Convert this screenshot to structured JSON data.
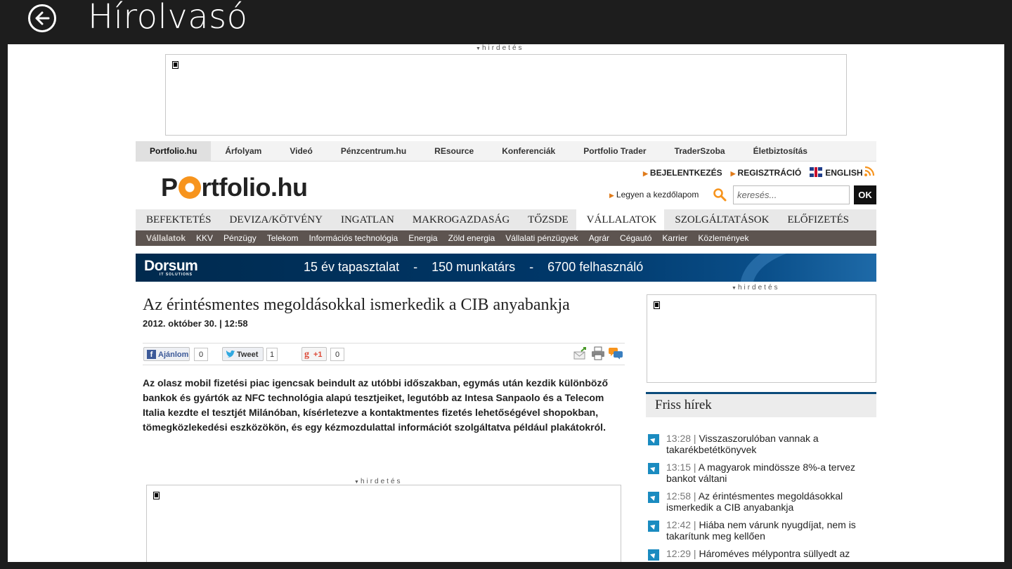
{
  "app": {
    "title": "Hírolvasó"
  },
  "ads": {
    "label": "hirdetés"
  },
  "topnav": [
    "Portfolio.hu",
    "Árfolyam",
    "Videó",
    "Pénzcentrum.hu",
    "REsource",
    "Konferenciák",
    "Portfolio Trader",
    "TraderSzoba",
    "Életbiztosítás"
  ],
  "logo": {
    "pre": "P",
    "post": "rtfolio.hu"
  },
  "toplinks": {
    "login": "BEJELENTKEZÉS",
    "register": "REGISZTRÁCIÓ",
    "english": "ENGLISH"
  },
  "home_link": "Legyen a kezdőlapom",
  "search": {
    "placeholder": "keresés...",
    "button": "OK"
  },
  "mainnav": [
    "BEFEKTETÉS",
    "DEVIZA/KÖTVÉNY",
    "INGATLAN",
    "MAKROGAZDASÁG",
    "TŐZSDE",
    "VÁLLALATOK",
    "SZOLGÁLTATÁSOK",
    "ELŐFIZETÉS"
  ],
  "subnav": [
    "Vállalatok",
    "KKV",
    "Pénzügy",
    "Telekom",
    "Információs technológia",
    "Energia",
    "Zöld energia",
    "Vállalati pénzügyek",
    "Agrár",
    "Cégautó",
    "Karrier",
    "Közlemények"
  ],
  "banner": {
    "brand": "Dorsum",
    "brand_sub": "IT SOLUTIONS",
    "slogan": "15 év tapasztalat    -    150 munkatárs    -    6700 felhasználó"
  },
  "article": {
    "title": "Az érintésmentes megoldásokkal ismerkedik a CIB anyabankja",
    "date": "2012. október 30. | 12:58",
    "lead": "Az olasz mobil fizetési piac igencsak beindult az utóbbi időszakban, egymás után kezdik különböző bankok és gyártók az NFC technológia alapú tesztjeiket, legutóbb az Intesa Sanpaolo és a Telecom Italia kezdte el tesztjét Milánóban, kísérletezve a kontaktmentes fizetés lehetőségével shopokban, tömegközlekedési eszközökön, és egy kézmozdulattal információt szolgáltatva például plakátokról."
  },
  "share": {
    "like": "Ajánlom",
    "like_count": "0",
    "tweet": "Tweet",
    "tweet_count": "1",
    "gplus": "+1",
    "gplus_count": "0"
  },
  "sidebar": {
    "title": "Friss hírek",
    "news": [
      {
        "time": "13:28",
        "text": "Visszaszorulóban vannak a takarékbetétkönyvek"
      },
      {
        "time": "13:15",
        "text": "A magyarok mindössze 8%-a tervez bankot váltani"
      },
      {
        "time": "12:58",
        "text": "Az érintésmentes megoldásokkal ismerkedik a CIB anyabankja"
      },
      {
        "time": "12:42",
        "text": "Hiába nem várunk nyugdíjat, nem is takarítunk meg kellően"
      },
      {
        "time": "12:29",
        "text": "Hároméves mélypontra süllyedt az"
      }
    ]
  },
  "colors": {
    "accent": "#f7941d",
    "subnav_bg": "#5d5450",
    "banner_bg": "#00386a",
    "news_icon": "#1a8bc0"
  }
}
